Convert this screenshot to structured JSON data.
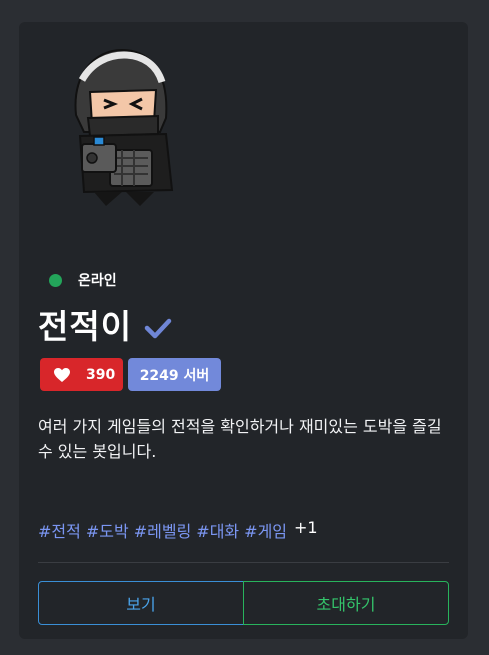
{
  "bot": {
    "status": "온라인",
    "name": "전적이",
    "votes": "390",
    "servers": "2249 서버",
    "description": "여러 가지 게임들의 전적을 확인하거나 재미있는 도박을 즐길 수 있는 봇입니다.",
    "tags": [
      "#전적",
      "#도박",
      "#레벨링",
      "#대화",
      "#게임"
    ],
    "more_tags": "+1"
  },
  "actions": {
    "view_label": "보기",
    "invite_label": "초대하기"
  },
  "icons": {
    "status": "online-dot-icon",
    "verified": "checkmark-icon",
    "votes": "heart-icon"
  },
  "colors": {
    "online": "#23a55a",
    "votes_badge": "#d8262a",
    "servers_badge": "#7289da",
    "tag": "#7b96f2",
    "view_button": "#3a8fd6",
    "invite_button": "#28b35c"
  }
}
